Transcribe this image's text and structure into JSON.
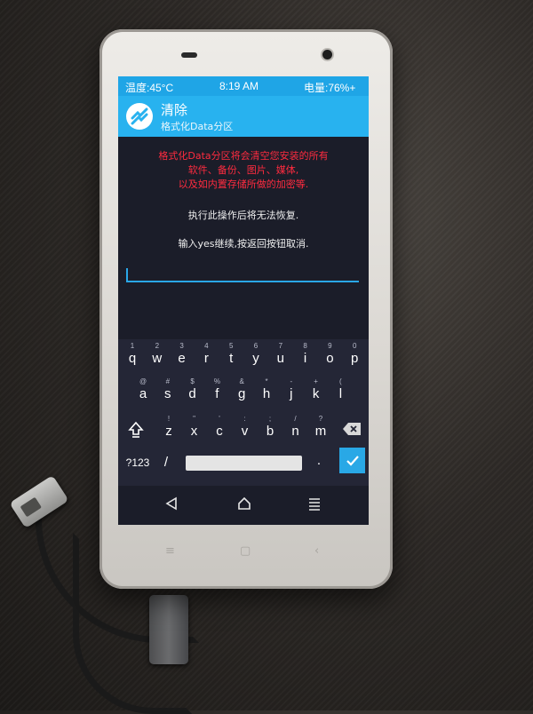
{
  "status_bar": {
    "temperature": "温度:45°C",
    "time": "8:19 AM",
    "battery": "电量:76%+"
  },
  "header": {
    "title": "清除",
    "subtitle": "格式化Data分区"
  },
  "warning_lines": [
    "格式化Data分区将会清空您安装的所有",
    "软件、备份、图片、媒体,",
    "以及如内置存储所做的加密等."
  ],
  "notice": "执行此操作后将无法恢复.",
  "prompt": "输入yes继续,按返回按钮取消.",
  "input": {
    "value": ""
  },
  "keyboard": {
    "row1": {
      "keys": [
        "q",
        "w",
        "e",
        "r",
        "t",
        "y",
        "u",
        "i",
        "o",
        "p"
      ],
      "hints": [
        "1",
        "2",
        "3",
        "4",
        "5",
        "6",
        "7",
        "8",
        "9",
        "0"
      ]
    },
    "row2": {
      "keys": [
        "a",
        "s",
        "d",
        "f",
        "g",
        "h",
        "j",
        "k",
        "l"
      ],
      "hints": [
        "@",
        "#",
        "$",
        "%",
        "&",
        "*",
        "-",
        "+",
        "("
      ]
    },
    "row3": {
      "keys": [
        "z",
        "x",
        "c",
        "v",
        "b",
        "n",
        "m"
      ],
      "hints": [
        "!",
        "\"",
        "'",
        ":",
        ";",
        "/",
        "?"
      ]
    },
    "symbols_label": "?123",
    "slash_key": "/",
    "period_key": ".",
    "shift_icon": "shift-arrow-icon",
    "backspace_icon": "backspace-icon",
    "enter_icon": "checkmark-icon"
  },
  "navbar": {
    "back_icon": "back-triangle-icon",
    "home_icon": "home-icon",
    "menu_icon": "menu-lines-icon"
  },
  "colors": {
    "accent": "#28b2ef",
    "warning": "#ff2b3f",
    "enter_key": "#29a8e6"
  }
}
